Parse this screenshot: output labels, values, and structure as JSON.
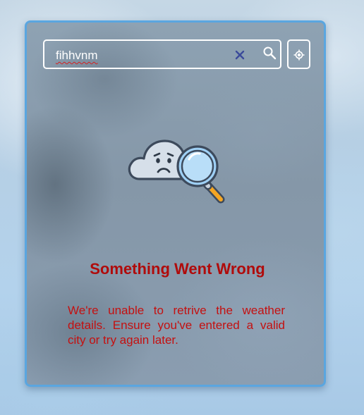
{
  "search": {
    "value": "fihhvnm",
    "clear_icon": "close-icon",
    "search_icon": "search-icon"
  },
  "location_button": {
    "icon": "crosshair-icon"
  },
  "error": {
    "illustration": "sad-cloud-magnifier",
    "title": "Something Went Wrong",
    "message": "We're unable to retrive the weather details. Ensure you've entered a valid city or try again later."
  },
  "colors": {
    "card_border": "#5aa6e0",
    "error_title": "#b00b0b",
    "error_text": "#c41010",
    "clear_icon": "#3b4a9a",
    "magnifier_handle": "#f5a623"
  }
}
